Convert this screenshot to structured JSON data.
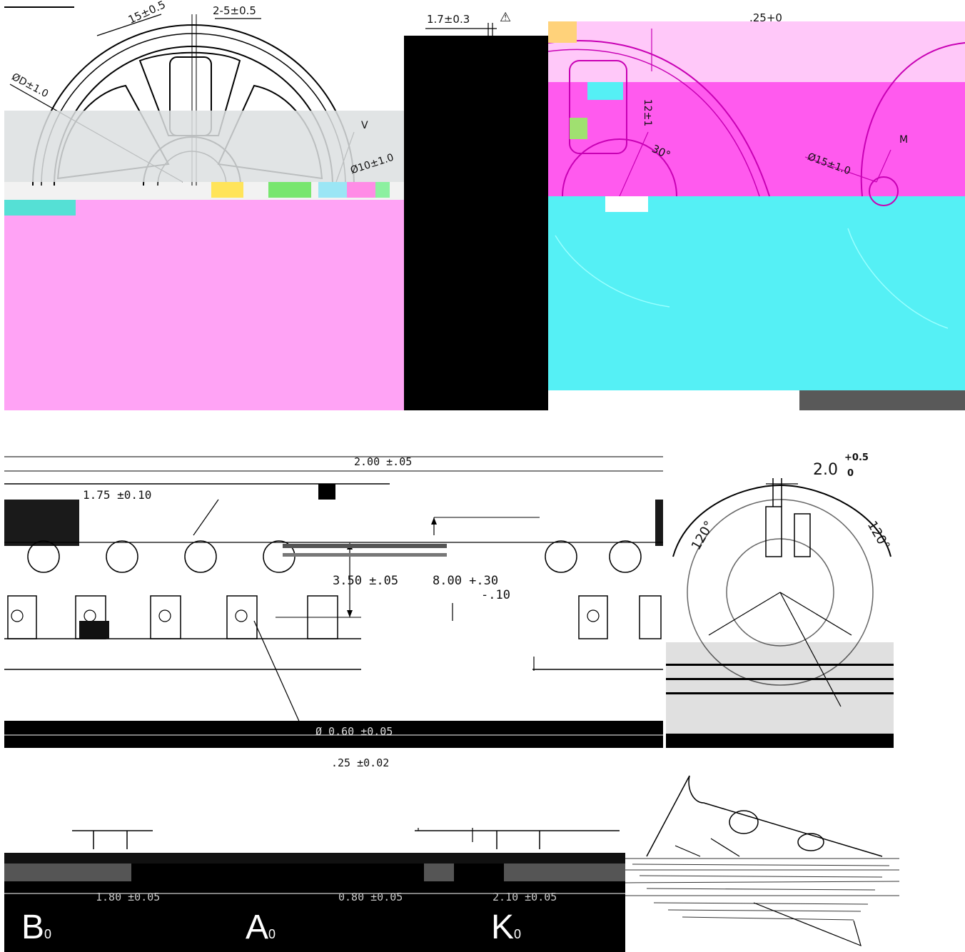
{
  "reel_front": {
    "dim_rim_width": "15±0.5",
    "dim_slot": "2-5±0.5",
    "dim_outer_dia": "ØD±1.0",
    "dim_hole": "Ø10±1.0",
    "note_v": "V"
  },
  "reel_thickness": {
    "dim_wall": "1.7±0.3",
    "warning": "⚠"
  },
  "reel_side": {
    "dim_top": ".25+0",
    "dim_angle": "30°",
    "dim_hub": "Ø15±1.0",
    "note_m": "M",
    "dim_vertical": "12±1"
  },
  "tape_top": {
    "dim_pitch_hole": "2.00 ±.05",
    "dim_edge": "1.75 ±0.10",
    "dim_sprocket_pitch": "3.50 ±.05",
    "dim_width": "8.00 +.30",
    "dim_width_tol": "-.10",
    "dim_hole_dia": "Ø 0.60 ±0.05",
    "dim_thickness": ".25 ±0.02"
  },
  "hub_detail": {
    "dim_slot_width": "2.0",
    "dim_slot_tol": "+0.5",
    "dim_slot_tol_low": "0",
    "dim_angle_left": "120°",
    "dim_angle_right": "120°"
  },
  "pocket_section": {
    "dim_b0": "1.80 ±0.05",
    "dim_a0": "0.80 ±0.05",
    "dim_k0": "2.10 ±0.05",
    "label_b": "B",
    "label_b_sub": "0",
    "label_a": "A",
    "label_a_sub": "0",
    "label_k": "K",
    "label_k_sub": "0"
  },
  "colors": {
    "pink": "#ffa3f5",
    "magenta": "#ff5aee",
    "light_pink": "#ffc8f9",
    "cyan": "#55f0f5",
    "gray_band": "#dcdfe0",
    "black": "#000000",
    "dark_gray": "#595959"
  }
}
